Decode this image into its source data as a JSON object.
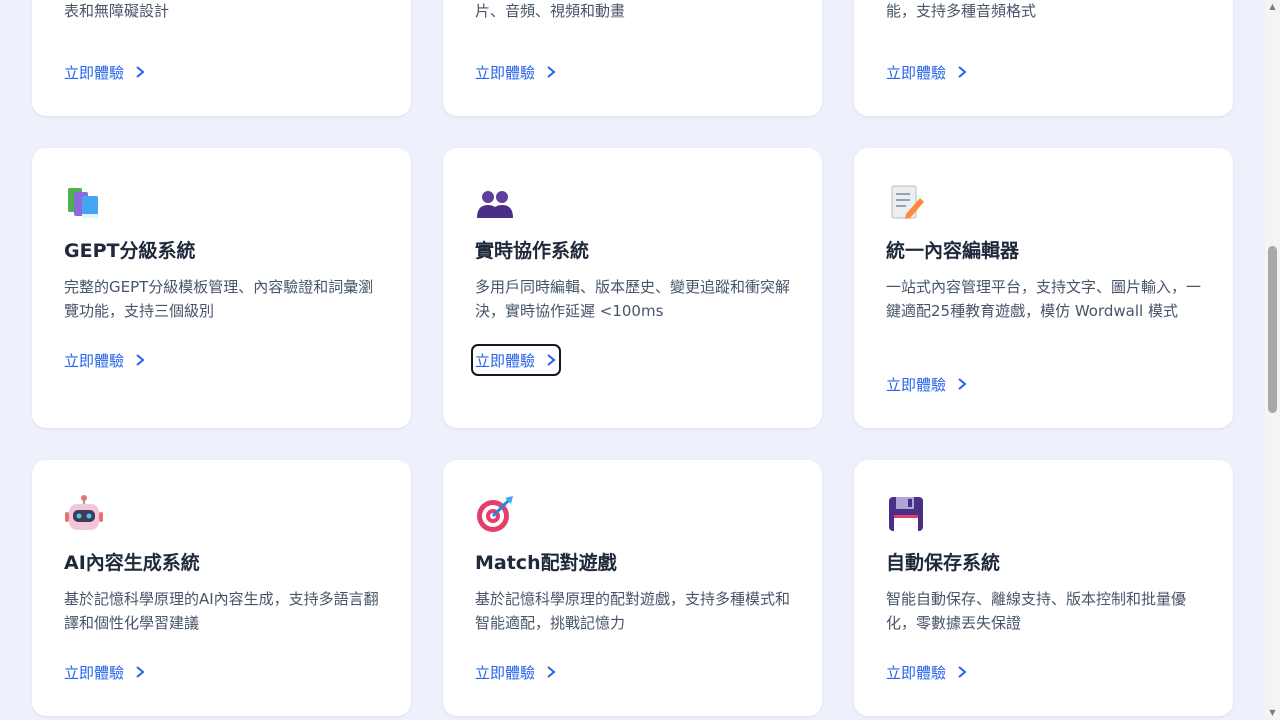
{
  "cards": [
    {
      "desc": "完整的富文本編輯功能，支持格式化、表格、列表和無障礙設計",
      "link": "立即體驗"
    },
    {
      "desc": "完整的多媒體上傳、管理和預覽功能，支持圖片、音頻、視頻和動畫",
      "link": "立即體驗"
    },
    {
      "desc": "完整的語音錄製、播放、語音識別和語音合成功能，支持多種音頻格式",
      "link": "立即體驗"
    },
    {
      "icon": "books-icon",
      "title": "GEPT分級系統",
      "desc": "完整的GEPT分級模板管理、內容驗證和詞彙瀏覽功能，支持三個級別",
      "link": "立即體驗"
    },
    {
      "icon": "people-icon",
      "title": "實時協作系統",
      "desc": "多用戶同時編輯、版本歷史、變更追蹤和衝突解決，實時協作延遲 <100ms",
      "link": "立即體驗"
    },
    {
      "icon": "memo-icon",
      "title": "統一內容編輯器",
      "desc": "一站式內容管理平台，支持文字、圖片輸入，一鍵適配25種教育遊戲，模仿 Wordwall 模式",
      "link": "立即體驗"
    },
    {
      "icon": "robot-icon",
      "title": "AI內容生成系統",
      "desc": "基於記憶科學原理的AI內容生成，支持多語言翻譯和個性化學習建議",
      "link": "立即體驗"
    },
    {
      "icon": "target-icon",
      "title": "Match配對遊戲",
      "desc": "基於記憶科學原理的配對遊戲，支持多種模式和智能適配，挑戰記憶力",
      "link": "立即體驗"
    },
    {
      "icon": "floppy-disk-icon",
      "title": "自動保存系統",
      "desc": "智能自動保存、離線支持、版本控制和批量優化，零數據丟失保證",
      "link": "立即體驗"
    }
  ],
  "colors": {
    "accent": "#2563eb",
    "background": "#eef1fb",
    "card": "#ffffff"
  }
}
